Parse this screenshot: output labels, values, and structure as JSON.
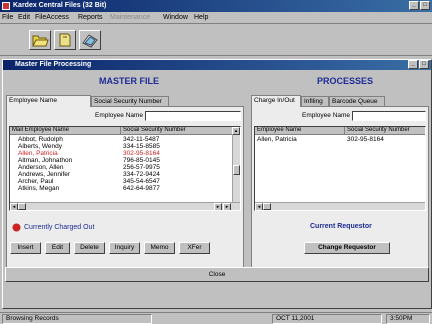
{
  "app": {
    "title": "Kardex Central Files (32 Bit)"
  },
  "menu": {
    "file": "File",
    "edit": "Edit",
    "fileaccess": "FileAccess",
    "reports": "Reports",
    "maintenance": "Maintenance",
    "window": "Window",
    "help": "Help"
  },
  "child": {
    "title": "Master File Processing"
  },
  "master": {
    "heading": "MASTER FILE",
    "tabs": [
      "Employee Name",
      "Social Security Number"
    ],
    "search_label": "Employee Name",
    "columns": [
      "Mail Employee Name",
      "Social Security Number"
    ],
    "rows": [
      {
        "name": "Abbot, Rudolph",
        "ssn": "342-11-5487",
        "charged": false
      },
      {
        "name": "Alberts, Wendy",
        "ssn": "334-15-8585",
        "charged": false
      },
      {
        "name": "Allen, Patricia",
        "ssn": "302-95-8164",
        "charged": true
      },
      {
        "name": "Altman, Johnathon",
        "ssn": "796-85-0145",
        "charged": false
      },
      {
        "name": "Anderson, Allen",
        "ssn": "256-57-9975",
        "charged": false
      },
      {
        "name": "Andrews, Jennifer",
        "ssn": "334-72-9424",
        "charged": false
      },
      {
        "name": "Archer, Paul",
        "ssn": "345-54-6547",
        "charged": false
      },
      {
        "name": "Atkins, Megan",
        "ssn": "642-64-9877",
        "charged": false
      }
    ],
    "legend": "Currently Charged Out",
    "buttons": {
      "insert": "Insert",
      "edit": "Edit",
      "delete": "Delete",
      "inquiry": "Inquiry",
      "memo": "Memo",
      "xfer": "XFer"
    }
  },
  "processes": {
    "heading": "PROCESSES",
    "tabs": [
      "Charge In/Out",
      "Inflling",
      "Barcode Queue"
    ],
    "search_label": "Employee Name",
    "columns": [
      "Employee Name",
      "Social Security Number"
    ],
    "rows": [
      {
        "name": "Allen, Patricia",
        "ssn": "302-95-8164"
      }
    ],
    "current_label": "Current Requestor",
    "change_button": "Change Requestor"
  },
  "close_button": "Close",
  "status": {
    "message": "Browsing Records",
    "date": "OCT 11,2001",
    "time": "3:50PM"
  },
  "colors": {
    "accent": "#1e2b96",
    "charged": "#cc2222"
  }
}
